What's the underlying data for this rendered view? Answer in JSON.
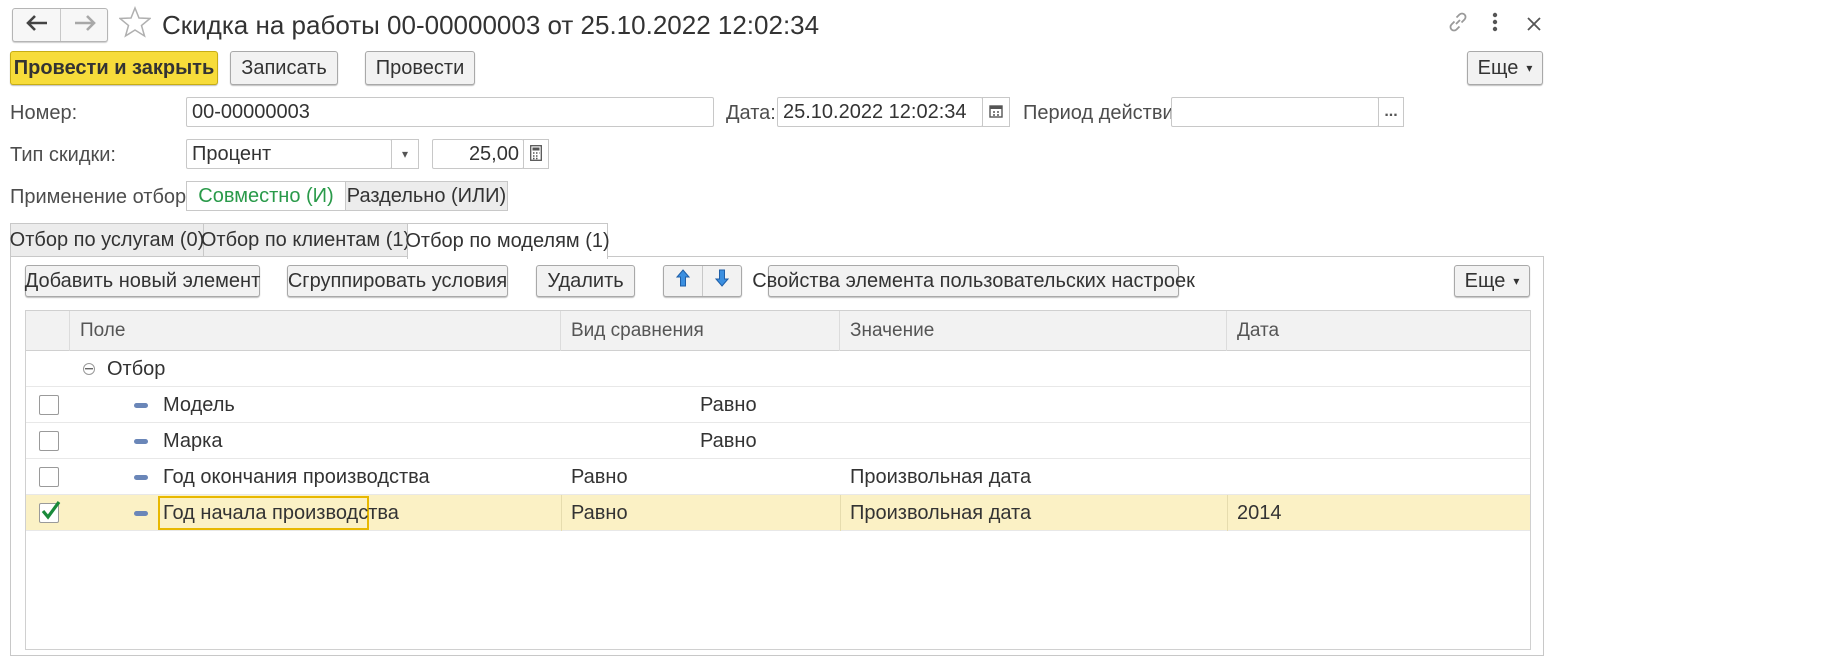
{
  "window": {
    "title": "Скидка на работы 00-00000003 от 25.10.2022 12:02:34"
  },
  "toolbar": {
    "post_close_label": "Провести и закрыть",
    "save_label": "Записать",
    "post_label": "Провести",
    "more_label": "Еще"
  },
  "form": {
    "number_label": "Номер:",
    "number_value": "00-00000003",
    "date_label": "Дата:",
    "date_value": "25.10.2022 12:02:34",
    "period_label": "Период действия:",
    "period_value": "",
    "period_button": "...",
    "discount_type_label": "Тип скидки:",
    "discount_type_value": "Процент",
    "discount_amount": "25,00",
    "filter_mode_label": "Применение отборов:",
    "filter_mode_options": [
      "Совместно (И)",
      "Раздельно (ИЛИ)"
    ],
    "filter_mode_selected": "Совместно (И)"
  },
  "tabs": [
    {
      "label": "Отбор по услугам (0)"
    },
    {
      "label": "Отбор по клиентам (1)"
    },
    {
      "label": "Отбор по моделям (1)"
    }
  ],
  "active_tab": "Отбор по моделям (1)",
  "panel_toolbar": {
    "add_label": "Добавить новый элемент",
    "group_label": "Сгруппировать условия",
    "delete_label": "Удалить",
    "properties_label": "Свойства элемента пользовательских настроек",
    "more_label": "Еще"
  },
  "table": {
    "columns": [
      "Поле",
      "Вид сравнения",
      "Значение",
      "Дата"
    ],
    "group_label": "Отбор",
    "rows": [
      {
        "checked": false,
        "field": "Модель",
        "comparison": "Равно",
        "value": "",
        "date": ""
      },
      {
        "checked": false,
        "field": "Марка",
        "comparison": "Равно",
        "value": "",
        "date": ""
      },
      {
        "checked": false,
        "field": "Год окончания производства",
        "comparison": "Равно",
        "value": "Произвольная дата",
        "date": ""
      },
      {
        "checked": true,
        "field": "Год начала производства",
        "comparison": "Равно",
        "value": "Произвольная дата",
        "date": "2014"
      }
    ]
  },
  "colors": {
    "primary_button": "#f7dc3a",
    "selected_row": "#fbf1c5",
    "selected_cell_border": "#e8b800",
    "filter_mode_selected_text": "#2a9a4a",
    "arrow_button": "#2b7ed8"
  },
  "icons": [
    "arrow-left-icon",
    "arrow-right-icon",
    "star-icon",
    "link-icon",
    "more-vertical-icon",
    "close-icon",
    "calendar-icon",
    "calculator-icon",
    "chevron-down-icon",
    "arrow-up-icon",
    "arrow-down-icon",
    "collapse-minus-icon",
    "checkmark-icon"
  ]
}
